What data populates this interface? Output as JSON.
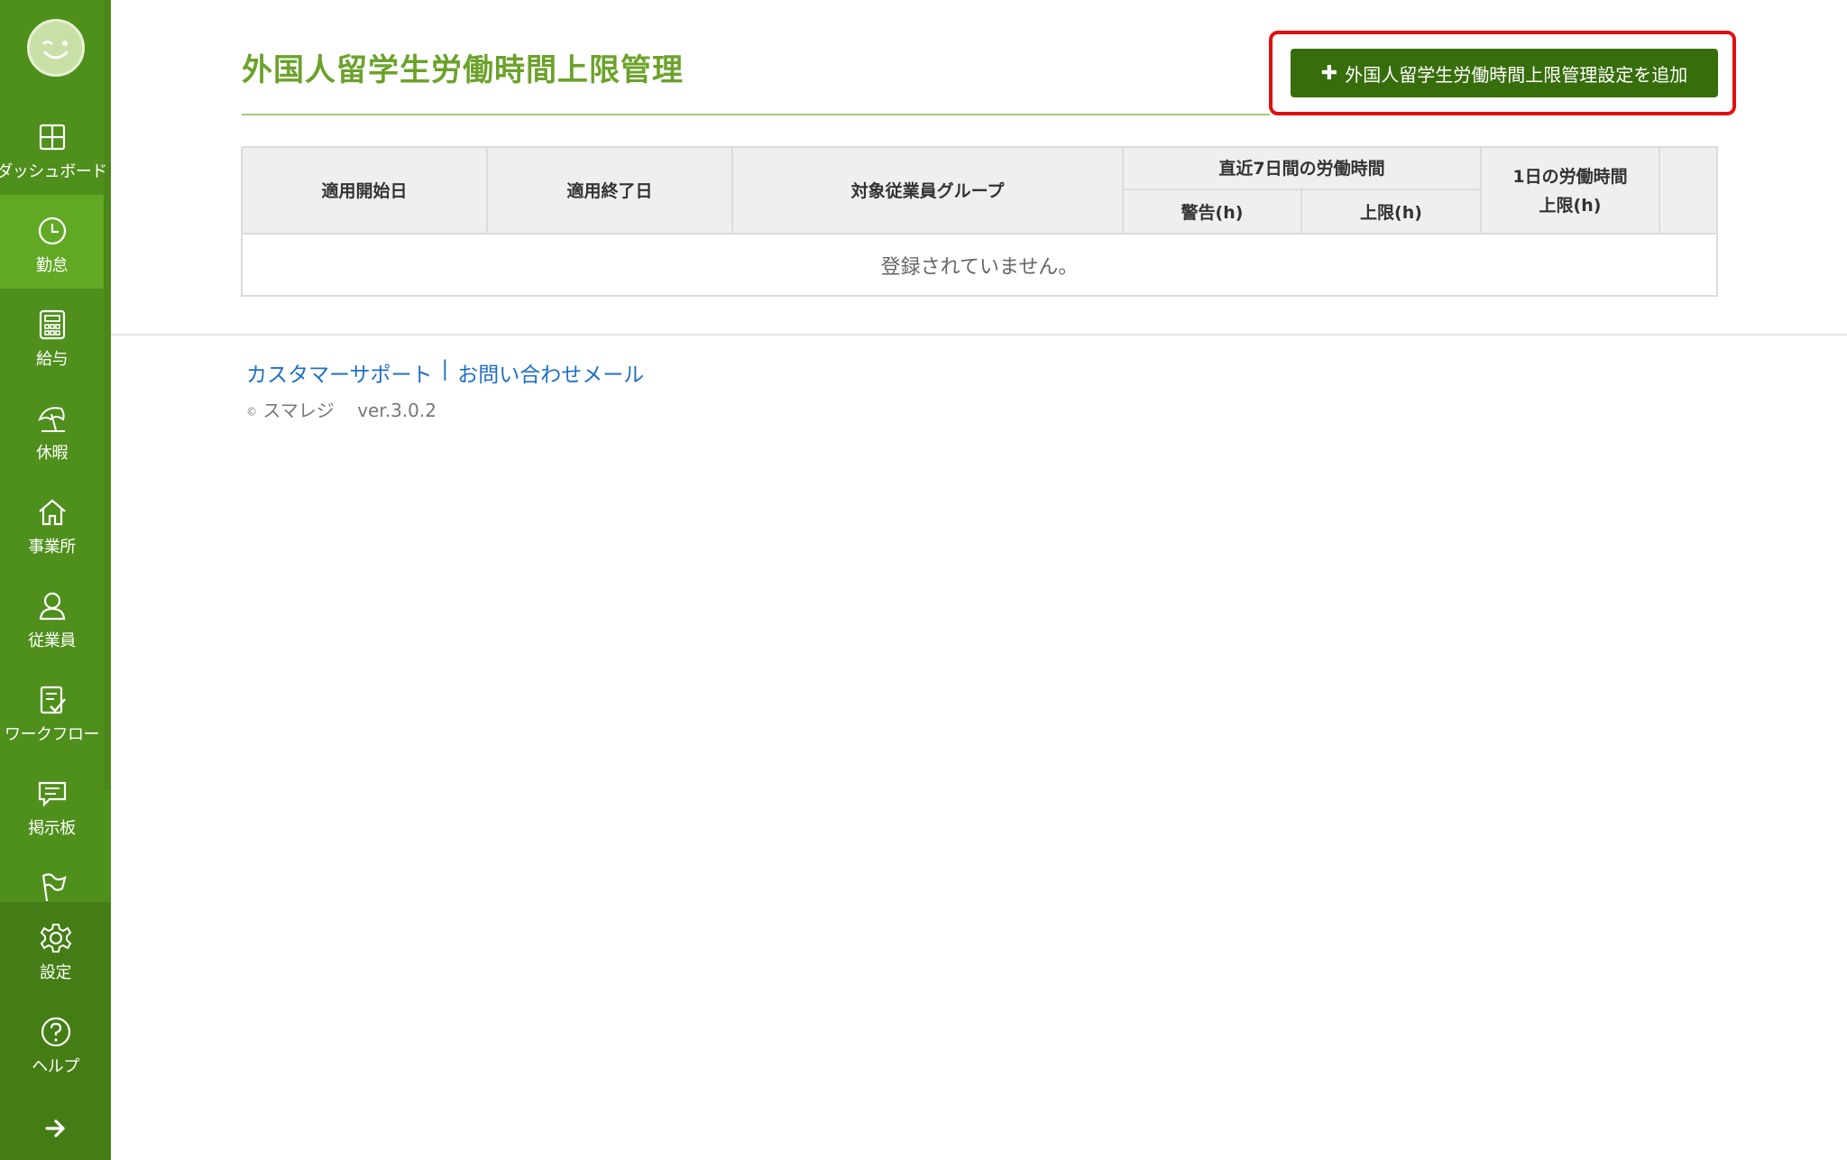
{
  "colors": {
    "sidebar": "#4f8f1c",
    "sidebar_active": "#61a925",
    "title": "#6ca22b",
    "button": "#386d0c",
    "highlight": "#e01010",
    "link": "#1f6fc5"
  },
  "sidebar": {
    "items": [
      {
        "label": "ダッシュボード",
        "icon": "dashboard-icon"
      },
      {
        "label": "勤怠",
        "icon": "clock-icon",
        "active": true
      },
      {
        "label": "給与",
        "icon": "calculator-icon"
      },
      {
        "label": "休暇",
        "icon": "beach-umbrella-icon"
      },
      {
        "label": "事業所",
        "icon": "home-icon"
      },
      {
        "label": "従業員",
        "icon": "person-icon"
      },
      {
        "label": "ワークフロー",
        "icon": "checklist-icon"
      },
      {
        "label": "掲示板",
        "icon": "chat-icon"
      },
      {
        "label": "",
        "icon": "flag-icon"
      }
    ],
    "bottom": [
      {
        "label": "設定",
        "icon": "gear-icon"
      },
      {
        "label": "ヘルプ",
        "icon": "help-icon"
      }
    ],
    "collapse_icon": "arrow-right-icon"
  },
  "main": {
    "title": "外国人留学生労働時間上限管理",
    "add_button": "外国人留学生労働時間上限管理設定を追加",
    "table": {
      "headers": {
        "start_date": "適用開始日",
        "end_date": "適用終了日",
        "group": "対象従業員グループ",
        "weekly": "直近7日間の労働時間",
        "weekly_warning": "警告(h)",
        "weekly_limit": "上限(h)",
        "daily_line1": "1日の労働時間",
        "daily_line2": "上限(h)"
      },
      "empty_message": "登録されていません。"
    }
  },
  "footer": {
    "support_link": "カスタマーサポート",
    "separator": "|",
    "contact_link": "お問い合わせメール",
    "copyright_symbol": "©",
    "brand": "スマレジ",
    "version": "ver.3.0.2"
  }
}
